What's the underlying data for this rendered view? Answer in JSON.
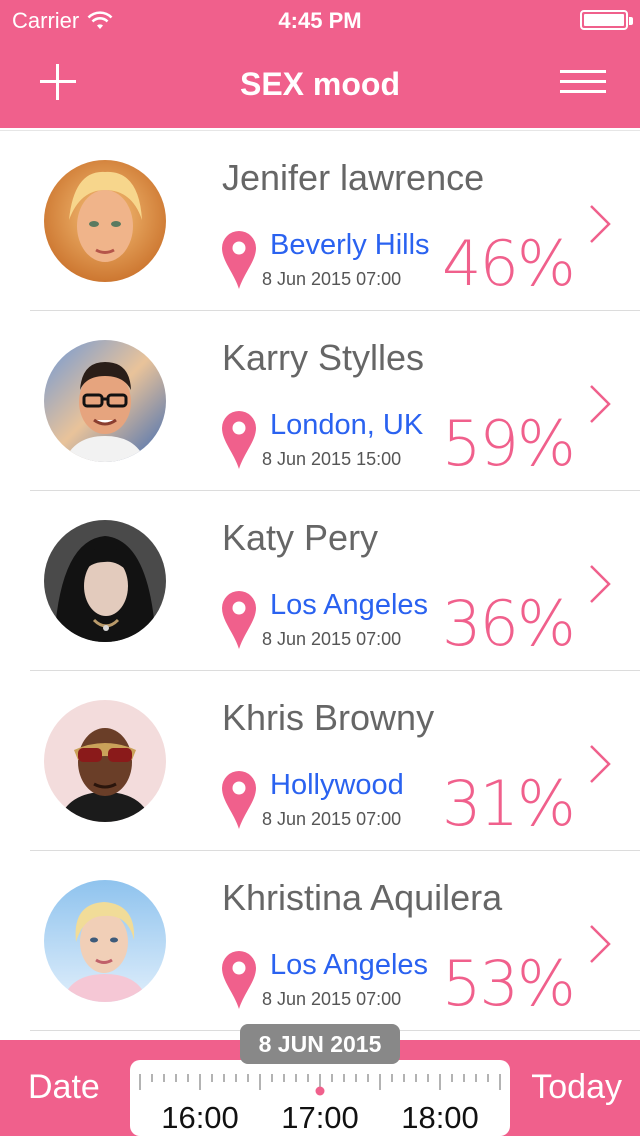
{
  "status_bar": {
    "carrier": "Carrier",
    "time": "4:45 PM"
  },
  "nav": {
    "title": "SEX mood",
    "add_icon": "plus-icon",
    "menu_icon": "hamburger-menu-icon"
  },
  "people": [
    {
      "name": "Jenifer lawrence",
      "location": "Beverly Hills",
      "datetime": "8 Jun 2015 07:00",
      "percent": "46%"
    },
    {
      "name": "Karry Stylles",
      "location": "London, UK",
      "datetime": "8 Jun 2015 15:00",
      "percent": "59%"
    },
    {
      "name": "Katy Pery",
      "location": "Los Angeles",
      "datetime": "8 Jun 2015 07:00",
      "percent": "36%"
    },
    {
      "name": "Khris Browny",
      "location": "Hollywood",
      "datetime": "8 Jun 2015 07:00",
      "percent": "31%"
    },
    {
      "name": "Khristina Aquilera",
      "location": "Los Angeles",
      "datetime": "8 Jun 2015 07:00",
      "percent": "53%"
    }
  ],
  "bottom": {
    "date_label": "Date",
    "today_label": "Today",
    "selected_date": "8 JUN 2015",
    "times": [
      "16:00",
      "17:00",
      "18:00"
    ]
  },
  "colors": {
    "accent": "#f0608c",
    "link": "#2a62f0",
    "text": "#666666"
  }
}
